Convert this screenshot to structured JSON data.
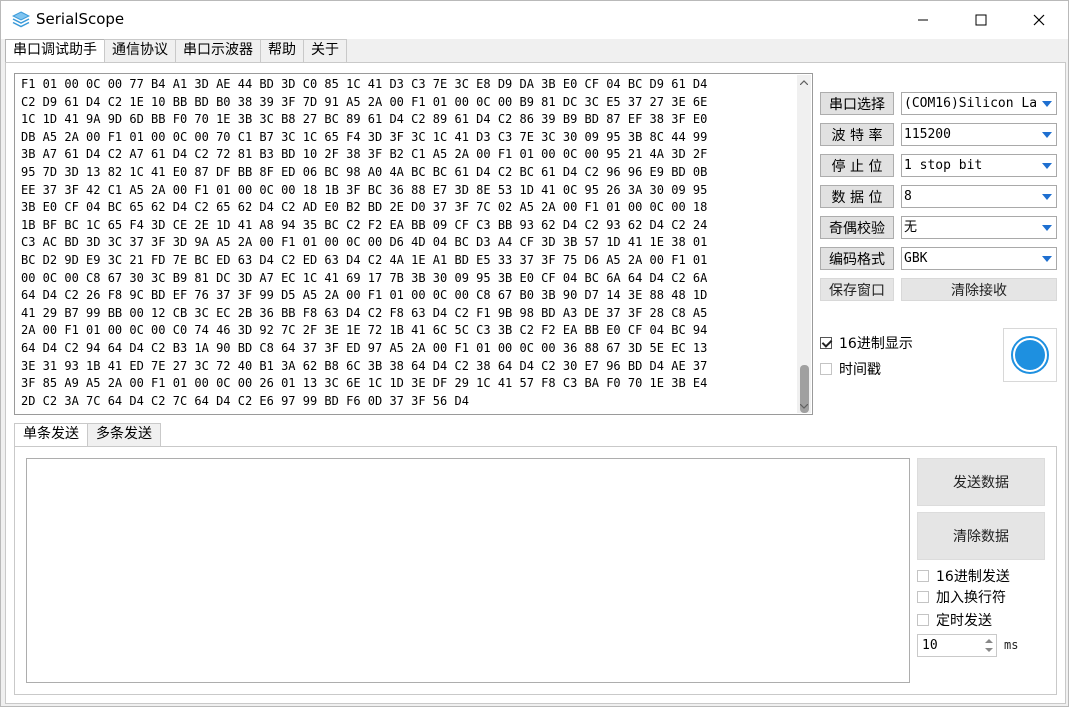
{
  "window": {
    "title": "SerialScope"
  },
  "top_tabs": [
    {
      "label": "串口调试助手",
      "active": true
    },
    {
      "label": "通信协议",
      "active": false
    },
    {
      "label": "串口示波器",
      "active": false
    },
    {
      "label": "帮助",
      "active": false
    },
    {
      "label": "关于",
      "active": false
    }
  ],
  "receive": {
    "text": "F1 01 00 0C 00 77 B4 A1 3D AE 44 BD 3D C0 85 1C 41 D3 C3 7E 3C E8 D9 DA 3B E0 CF 04 BC D9 61 D4\nC2 D9 61 D4 C2 1E 10 BB BD B0 38 39 3F 7D 91 A5 2A 00 F1 01 00 0C 00 B9 81 DC 3C E5 37 27 3E 6E\n1C 1D 41 9A 9D 6D BB F0 70 1E 3B 3C B8 27 BC 89 61 D4 C2 89 61 D4 C2 86 39 B9 BD 87 EF 38 3F E0\nDB A5 2A 00 F1 01 00 0C 00 70 C1 B7 3C 1C 65 F4 3D 3F 3C 1C 41 D3 C3 7E 3C 30 09 95 3B 8C 44 99\n3B A7 61 D4 C2 A7 61 D4 C2 72 81 B3 BD 10 2F 38 3F B2 C1 A5 2A 00 F1 01 00 0C 00 95 21 4A 3D 2F\n95 7D 3D 13 82 1C 41 E0 87 DF BB 8F ED 06 BC 98 A0 4A BC BC 61 D4 C2 BC 61 D4 C2 96 96 E9 BD 0B\nEE 37 3F 42 C1 A5 2A 00 F1 01 00 0C 00 18 1B 3F BC 36 88 E7 3D 8E 53 1D 41 0C 95 26 3A 30 09 95\n3B E0 CF 04 BC 65 62 D4 C2 65 62 D4 C2 AD E0 B2 BD 2E D0 37 3F 7C 02 A5 2A 00 F1 01 00 0C 00 18\n1B BF BC 1C 65 F4 3D CE 2E 1D 41 A8 94 35 BC C2 F2 EA BB 09 CF C3 BB 93 62 D4 C2 93 62 D4 C2 24\nC3 AC BD 3D 3C 37 3F 3D 9A A5 2A 00 F1 01 00 0C 00 D6 4D 04 BC D3 A4 CF 3D 3B 57 1D 41 1E 38 01\nBC D2 9D E9 3C 21 FD 7E BC ED 63 D4 C2 ED 63 D4 C2 4A 1E A1 BD E5 33 37 3F 75 D6 A5 2A 00 F1 01\n00 0C 00 C8 67 30 3C B9 81 DC 3D A7 EC 1C 41 69 17 7B 3B 30 09 95 3B E0 CF 04 BC 6A 64 D4 C2 6A\n64 D4 C2 26 F8 9C BD EF 76 37 3F 99 D5 A5 2A 00 F1 01 00 0C 00 C8 67 B0 3B 90 D7 14 3E 88 48 1D\n41 29 B7 99 BB 00 12 CB 3C EC 2B 36 BB F8 63 D4 C2 F8 63 D4 C2 F1 9B 98 BD A3 DE 37 3F 28 C8 A5\n2A 00 F1 01 00 0C 00 C0 74 46 3D 92 7C 2F 3E 1E 72 1B 41 6C 5C C3 3B C2 F2 EA BB E0 CF 04 BC 94\n64 D4 C2 94 64 D4 C2 B3 1A 90 BD C8 64 37 3F ED 97 A5 2A 00 F1 01 00 0C 00 36 88 67 3D 5E EC 13\n3E 31 93 1B 41 ED 7E 27 3C 72 40 B1 3A 62 B8 6C 3B 38 64 D4 C2 38 64 D4 C2 30 E7 96 BD D4 AE 37\n3F 85 A9 A5 2A 00 F1 01 00 0C 00 26 01 13 3C 6E 1C 1D 3E DF 29 1C 41 57 F8 C3 BA F0 70 1E 3B E4\n2D C2 3A 7C 64 D4 C2 7C 64 D4 C2 E6 97 99 BD F6 0D 37 3F 56 D4"
  },
  "settings": {
    "port": {
      "label": "串口选择",
      "value": "(COM16)Silicon La"
    },
    "baud": {
      "label": "波 特 率",
      "value": "115200"
    },
    "stop": {
      "label": "停 止 位",
      "value": "1 stop bit"
    },
    "data": {
      "label": "数 据 位",
      "value": "8"
    },
    "parity": {
      "label": "奇偶校验",
      "value": "无"
    },
    "encoding": {
      "label": "编码格式",
      "value": "GBK"
    },
    "save_window": "保存窗口",
    "clear_receive": "清除接收",
    "hex_display": {
      "label": "16进制显示",
      "checked": true
    },
    "timestamp": {
      "label": "时间戳",
      "checked": false
    }
  },
  "status": {
    "color": "#1e90e0",
    "icon": "connection-status-icon"
  },
  "bottom_tabs": [
    {
      "label": "单条发送",
      "active": true
    },
    {
      "label": "多条发送",
      "active": false
    }
  ],
  "send": {
    "text": "",
    "send_button": "发送数据",
    "clear_button": "清除数据",
    "hex_send": {
      "label": "16进制发送",
      "checked": false
    },
    "add_newline": {
      "label": "加入换行符",
      "checked": false
    },
    "timed_send": {
      "label": "定时发送",
      "checked": false
    },
    "interval": "10",
    "interval_unit": "ms"
  },
  "colors": {
    "accent": "#1e6fd0",
    "button": "#e5e5e5"
  }
}
